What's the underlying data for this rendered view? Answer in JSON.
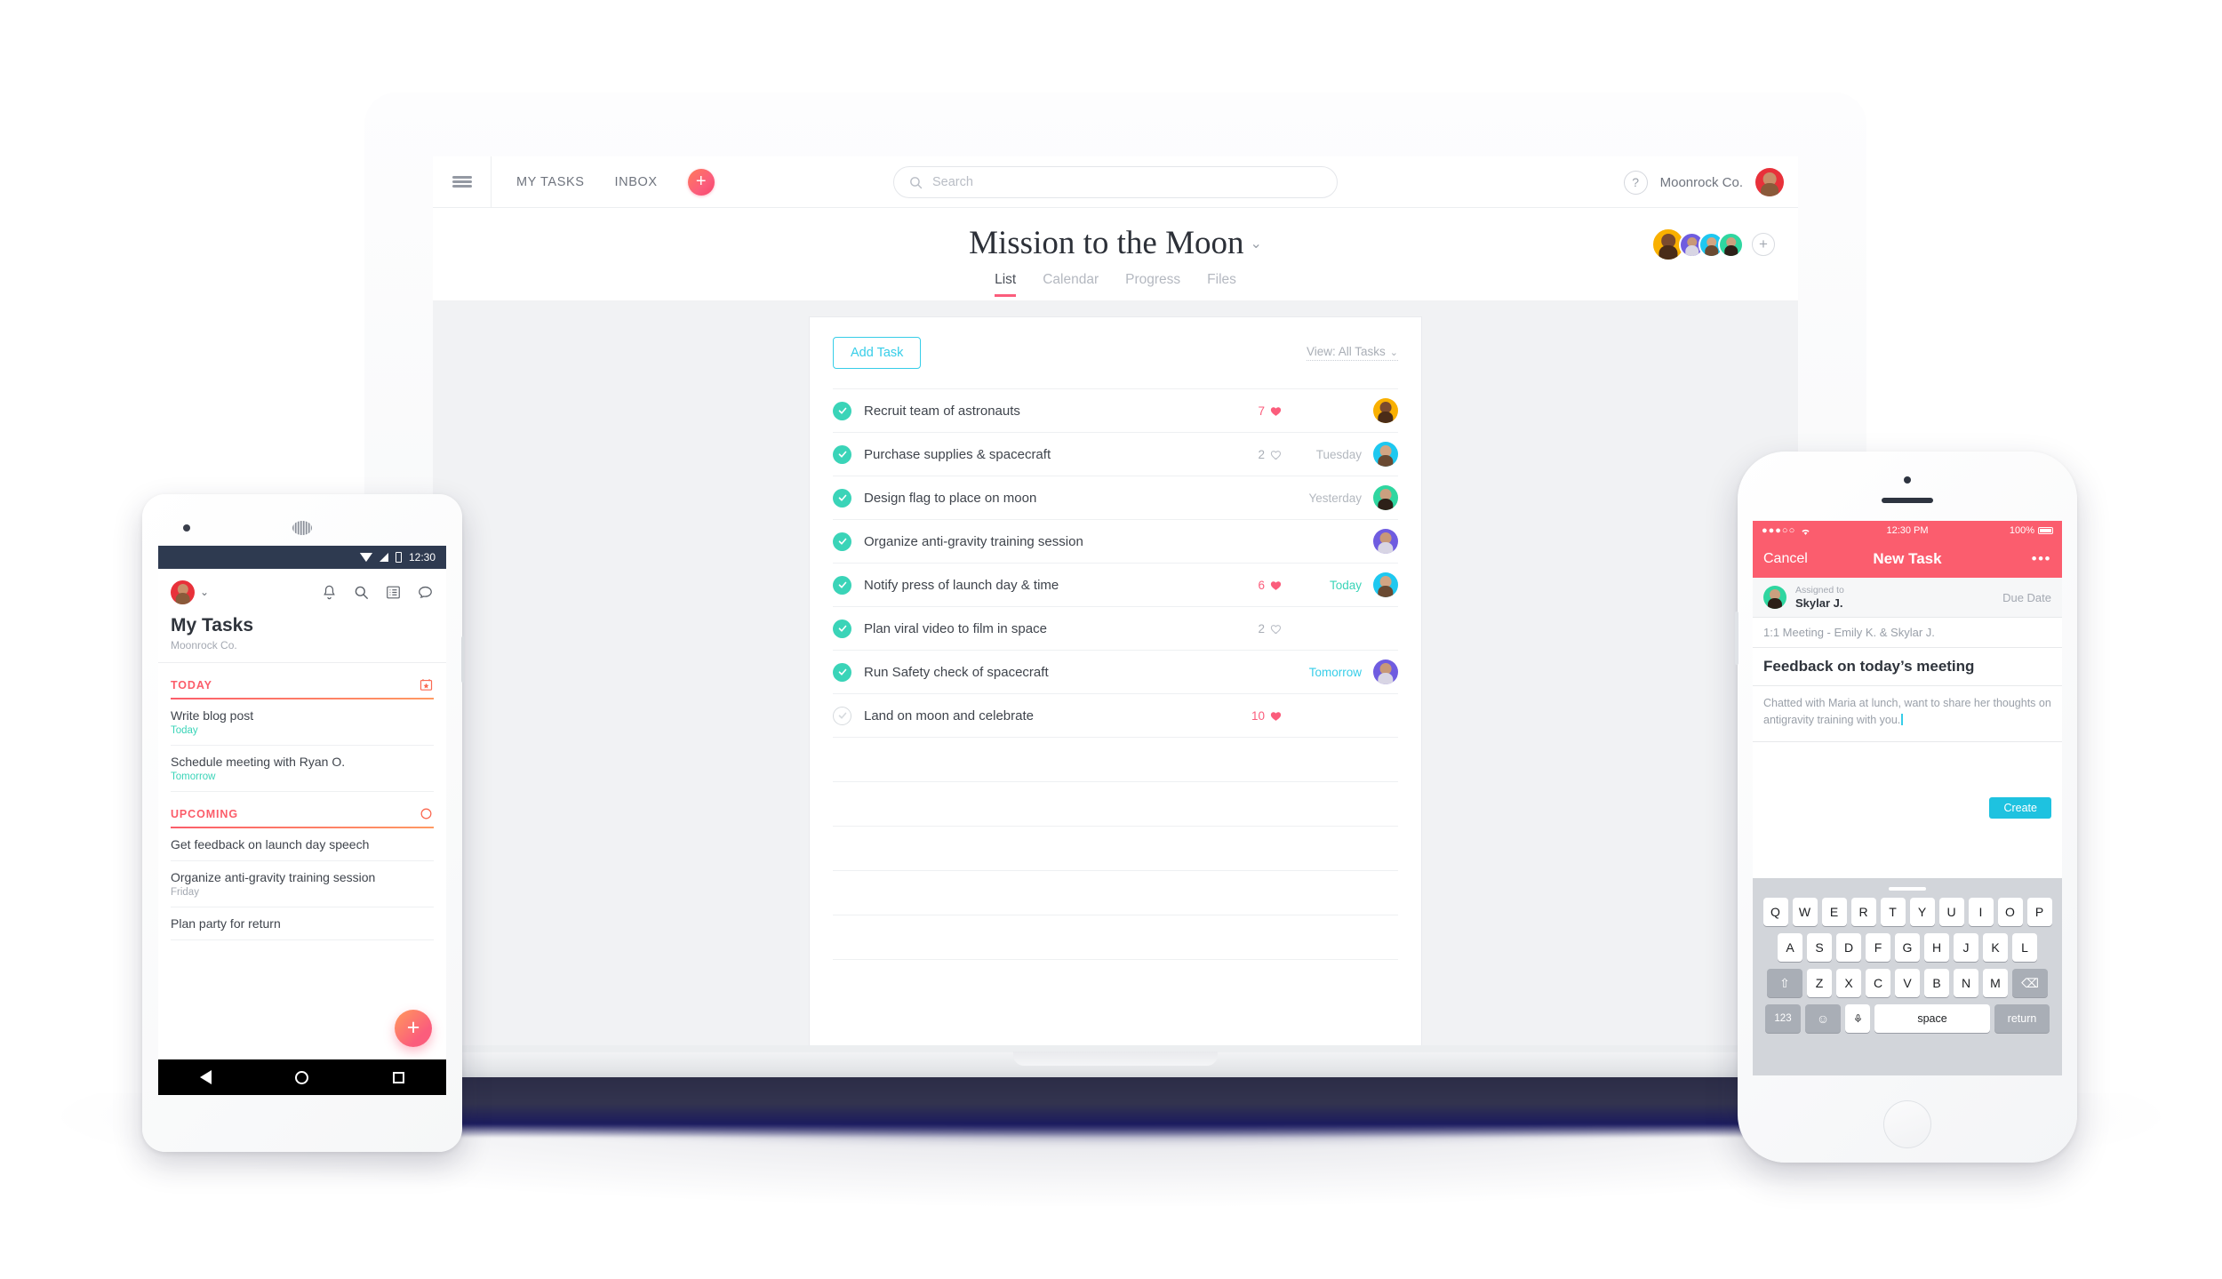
{
  "laptop": {
    "topbar": {
      "menu_icon": "hamburger-icon",
      "nav": [
        {
          "label": "MY TASKS"
        },
        {
          "label": "INBOX"
        }
      ],
      "add_label": "+",
      "search": {
        "placeholder": "Search",
        "icon": "search-icon",
        "value": ""
      },
      "help_label": "?",
      "org_name": "Moonrock Co."
    },
    "project": {
      "title": "Mission to the Moon",
      "caret": "⌄",
      "tabs": [
        {
          "label": "List",
          "active": true
        },
        {
          "label": "Calendar",
          "active": false
        },
        {
          "label": "Progress",
          "active": false
        },
        {
          "label": "Files",
          "active": false
        }
      ],
      "member_add_label": "+",
      "members": [
        {
          "color": "yellow"
        },
        {
          "color": "purple"
        },
        {
          "color": "cyan"
        },
        {
          "color": "green"
        }
      ]
    },
    "card": {
      "add_task_label": "Add Task",
      "view_label": "View: All Tasks",
      "view_caret": "⌄",
      "tasks": [
        {
          "name": "Recruit team of astronauts",
          "done": true,
          "likes": "7",
          "liked": true,
          "due": "",
          "due_state": "",
          "avatar": "yellow"
        },
        {
          "name": "Purchase supplies & spacecraft",
          "done": true,
          "likes": "2",
          "liked": false,
          "due": "Tuesday",
          "due_state": "",
          "avatar": "cyan"
        },
        {
          "name": "Design flag to place on moon",
          "done": true,
          "likes": "",
          "liked": false,
          "due": "Yesterday",
          "due_state": "",
          "avatar": "green"
        },
        {
          "name": "Organize anti-gravity training session",
          "done": true,
          "likes": "",
          "liked": false,
          "due": "",
          "due_state": "",
          "avatar": "purple"
        },
        {
          "name": "Notify press of launch day & time",
          "done": true,
          "likes": "6",
          "liked": true,
          "due": "Today",
          "due_state": "today",
          "avatar": "cyan"
        },
        {
          "name": "Plan viral video to film in space",
          "done": true,
          "likes": "2",
          "liked": false,
          "due": "",
          "due_state": "",
          "avatar": ""
        },
        {
          "name": "Run Safety check of spacecraft",
          "done": true,
          "likes": "",
          "liked": false,
          "due": "Tomorrow",
          "due_state": "tomorrow",
          "avatar": "purple"
        },
        {
          "name": "Land on moon and celebrate",
          "done": false,
          "likes": "10",
          "liked": true,
          "due": "",
          "due_state": "",
          "avatar": ""
        }
      ]
    }
  },
  "android": {
    "status": {
      "time": "12:30",
      "wifi_icon": "wifi-icon",
      "signal_icon": "signal-icon",
      "battery_icon": "battery-icon"
    },
    "header": {
      "avatar_color": "red",
      "caret": "⌄",
      "icons": [
        "bell-icon",
        "search-icon",
        "list-icon",
        "chat-icon"
      ]
    },
    "title": "My Tasks",
    "subtitle": "Moonrock Co.",
    "sections": [
      {
        "label": "TODAY",
        "icon": "calendar-star-icon",
        "items": [
          {
            "name": "Write blog post",
            "date": "Today",
            "date_grey": false
          },
          {
            "name": "Schedule meeting with Ryan O.",
            "date": "Tomorrow",
            "date_grey": false
          }
        ]
      },
      {
        "label": "UPCOMING",
        "icon": "circle-icon",
        "items": [
          {
            "name": "Get feedback on launch day speech",
            "date": "",
            "date_grey": true
          },
          {
            "name": "Organize anti-gravity training session",
            "date": "Friday",
            "date_grey": true
          },
          {
            "name": "Plan party for return",
            "date": "",
            "date_grey": true
          }
        ]
      }
    ],
    "fab_label": "+",
    "navbar": {
      "back_icon": "back-triangle-icon",
      "home_icon": "home-circle-icon",
      "recents_icon": "recents-square-icon"
    }
  },
  "iphone": {
    "status": {
      "dots": "●●●○○",
      "wifi_icon": "wifi-icon",
      "time": "12:30 PM",
      "battery_pct": "100%"
    },
    "navbar": {
      "cancel_label": "Cancel",
      "title": "New Task",
      "more_label": "•••"
    },
    "assignee": {
      "label": "Assigned to",
      "name": "Skylar J.",
      "avatar_color": "green",
      "due_label": "Due Date"
    },
    "project": "1:1 Meeting - Emily K. & Skylar J.",
    "task_title": "Feedback on today’s meeting",
    "notes": "Chatted with Maria at lunch, want to share her thoughts on antigravity training with you.",
    "create_label": "Create",
    "keyboard": {
      "row1": [
        "Q",
        "W",
        "E",
        "R",
        "T",
        "Y",
        "U",
        "I",
        "O",
        "P"
      ],
      "row2": [
        "A",
        "S",
        "D",
        "F",
        "G",
        "H",
        "J",
        "K",
        "L"
      ],
      "row3": [
        "Z",
        "X",
        "C",
        "V",
        "B",
        "N",
        "M"
      ],
      "shift_label": "⇧",
      "backspace_label": "⌫",
      "numbers_label": "123",
      "emoji_label": "☺",
      "mic_label": "♁",
      "space_label": "space",
      "return_label": "return"
    }
  },
  "colors": {
    "accent_pink": "#fb5d7c",
    "accent_teal": "#3ad4b8",
    "accent_cyan": "#36cde8",
    "ios_pink": "#fb5d6e",
    "android_status": "#2e3a50"
  }
}
